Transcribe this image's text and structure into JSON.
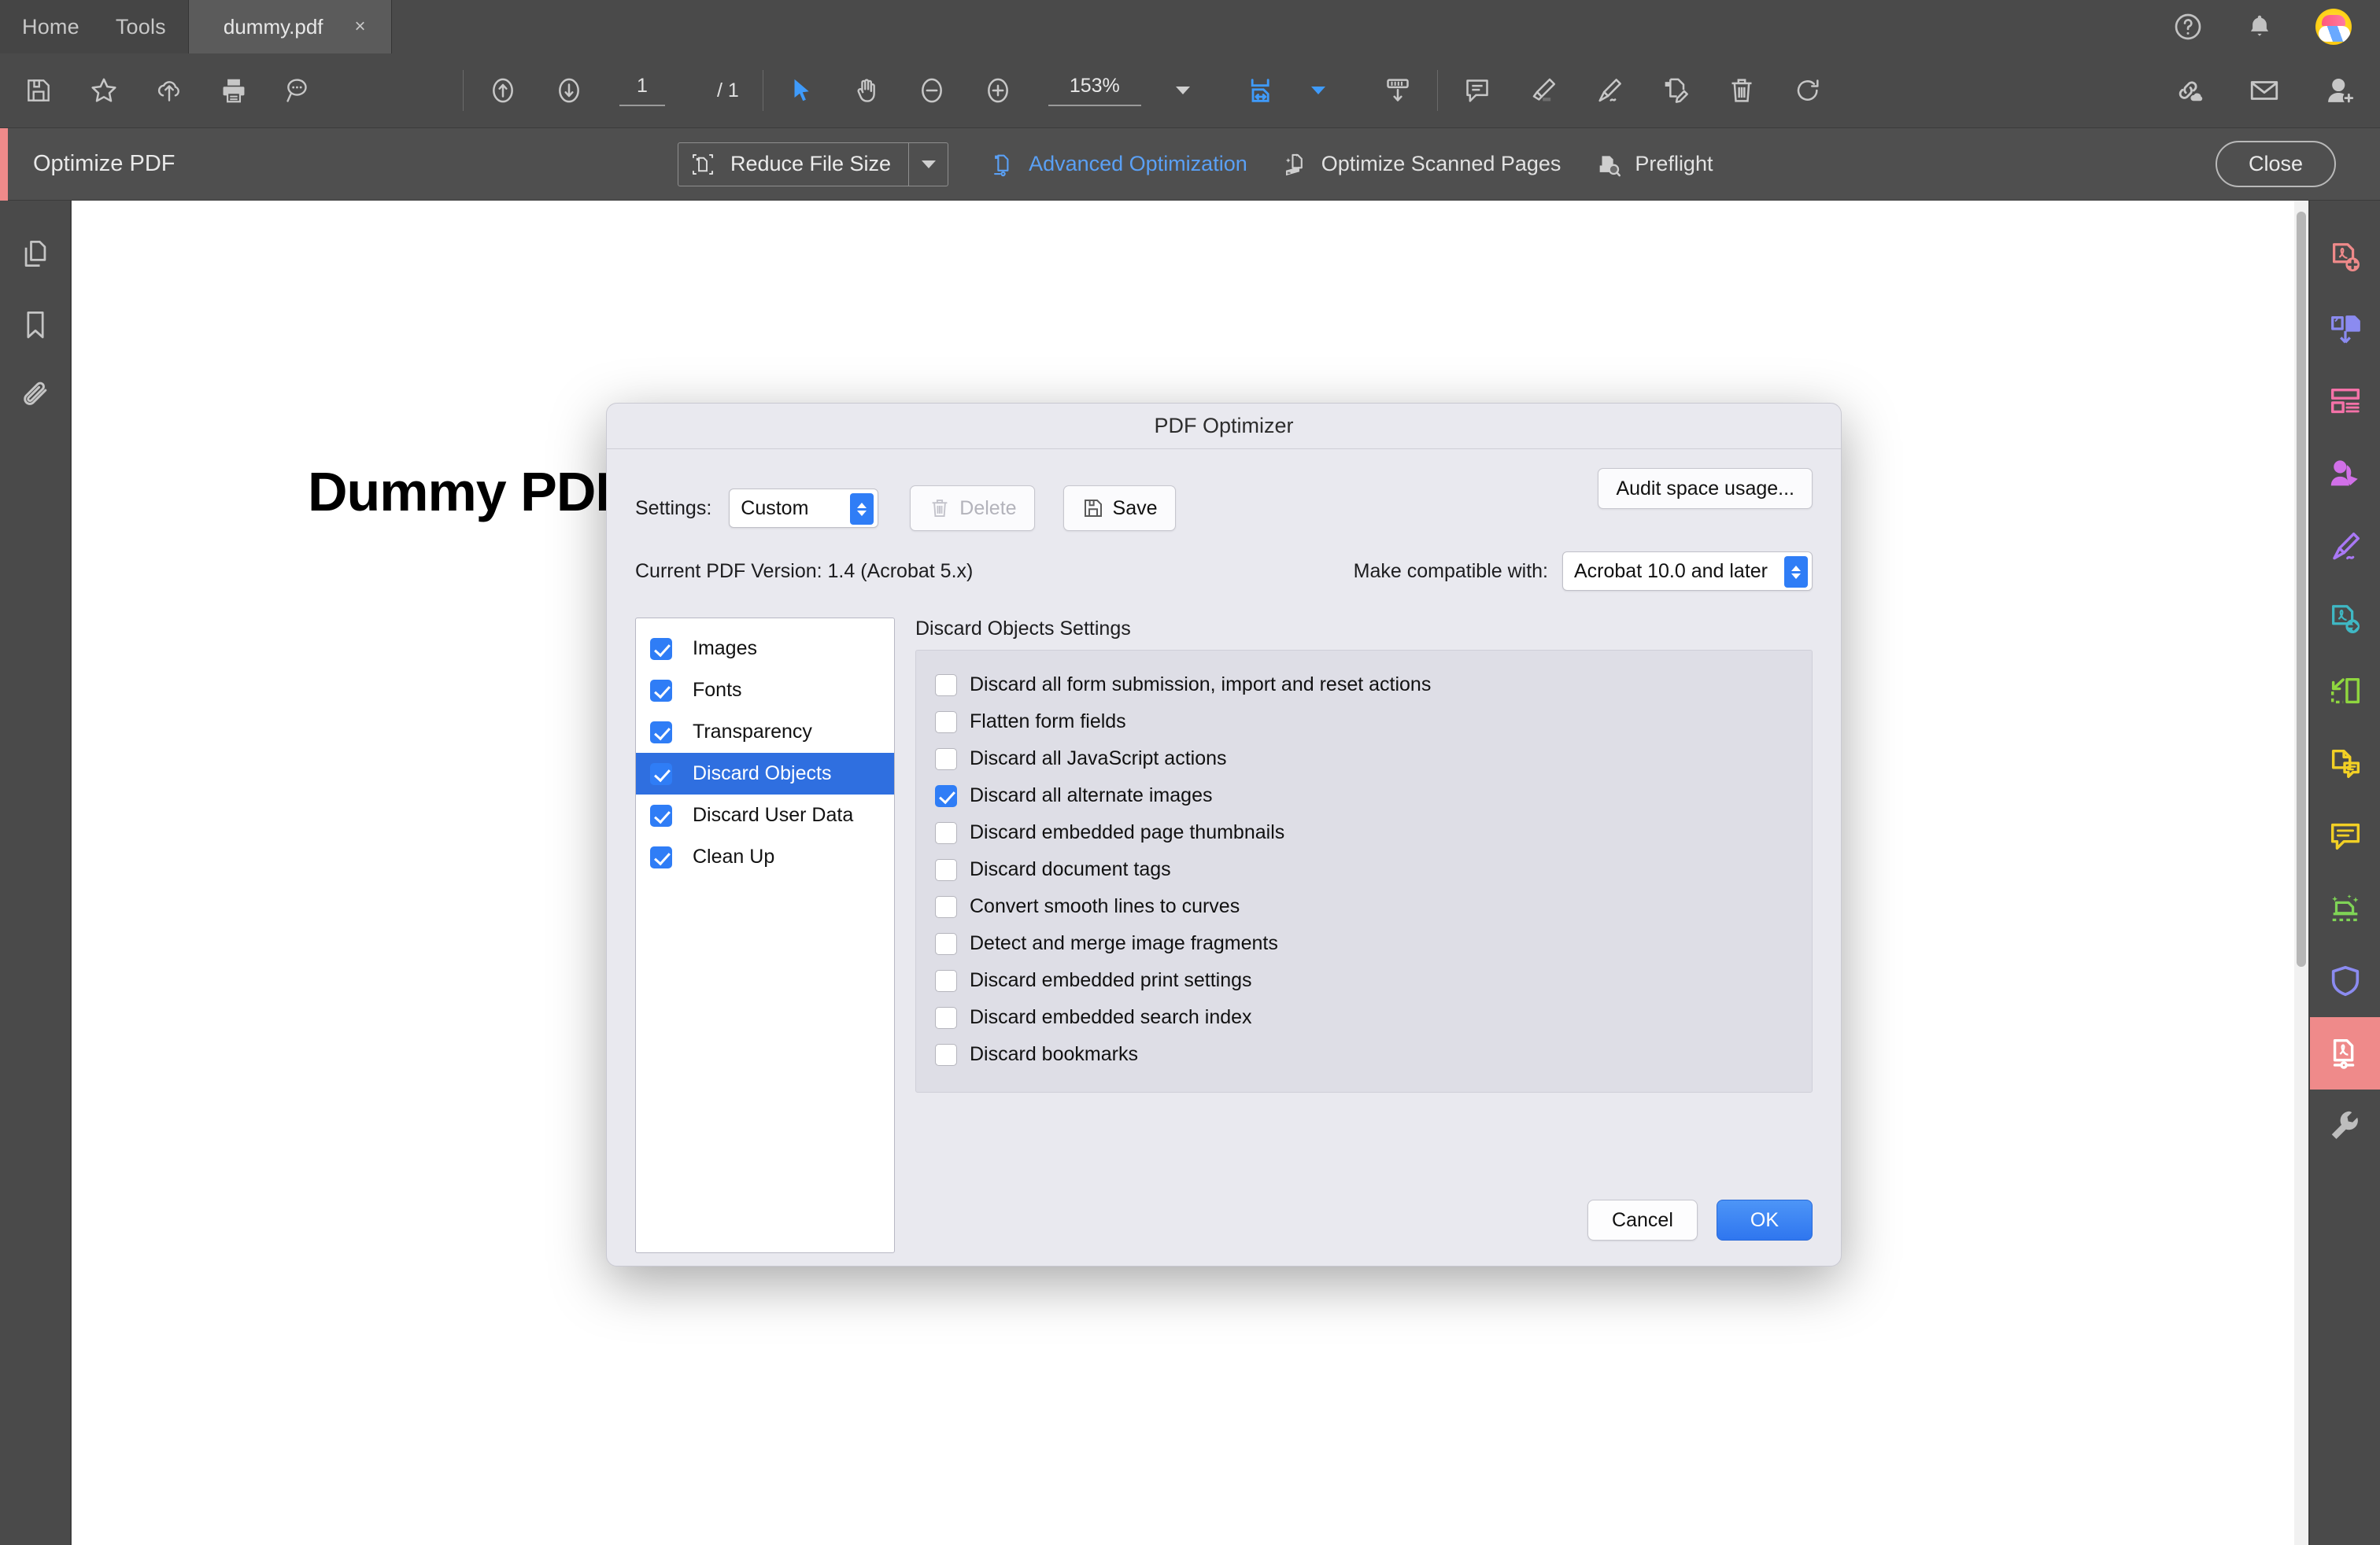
{
  "tabbar": {
    "home_label": "Home",
    "tools_label": "Tools",
    "doc_tab_title": "dummy.pdf",
    "doc_tab_close": "×",
    "help_icon": "help-circle-icon",
    "bell_icon": "notification-bell-icon",
    "avatar_icon": "user-avatar"
  },
  "toolbar": {
    "save_icon": "save-floppy-icon",
    "star_icon": "add-to-favorites-star-icon",
    "upload_icon": "upload-cloud-icon",
    "print_icon": "print-icon",
    "search_icon": "search-magnifier-icon",
    "prev_page_icon": "previous-page-arrow-up-icon",
    "next_page_icon": "next-page-arrow-down-icon",
    "page_current": "1",
    "page_total": "/ 1",
    "select_tool_icon": "select-cursor-icon",
    "hand_tool_icon": "hand-pan-icon",
    "zoom_out_icon": "zoom-out-minus-icon",
    "zoom_in_icon": "zoom-in-plus-icon",
    "zoom_value": "153%",
    "fit_page_icon": "fit-page-width-icon",
    "scroll_mode_icon": "scroll-mode-icon",
    "comment_icon": "add-comment-icon",
    "highlight_icon": "highlight-marker-icon",
    "sign_icon": "fill-and-sign-icon",
    "edit_pdf_icon": "edit-pdf-icon",
    "delete_icon": "delete-trash-icon",
    "rotate_icon": "rotate-clockwise-icon",
    "share_link_icon": "share-link-cloud-icon",
    "email_icon": "email-envelope-icon",
    "add_user_icon": "add-person-icon"
  },
  "optimize_bar": {
    "title": "Optimize PDF",
    "reduce_file_size": "Reduce File Size",
    "reduce_icon": "reduce-file-size-icon",
    "advanced_optimization": "Advanced Optimization",
    "advanced_icon": "advanced-optimization-icon",
    "optimize_scanned_pages": "Optimize Scanned Pages",
    "scanned_icon": "optimize-scanned-pages-icon",
    "preflight": "Preflight",
    "preflight_icon": "preflight-icon",
    "close_label": "Close",
    "active_color": "#5aa0f5",
    "accent_color": "#ef8a8a"
  },
  "left_rail": {
    "items": [
      {
        "icon": "page-thumbnails-icon",
        "name": "page-thumbnails"
      },
      {
        "icon": "bookmarks-icon",
        "name": "bookmarks"
      },
      {
        "icon": "attachments-paperclip-icon",
        "name": "attachments"
      }
    ]
  },
  "right_rail": {
    "items": [
      {
        "icon": "create-pdf-icon",
        "color": "#ef8a8a",
        "selected": false
      },
      {
        "icon": "combine-files-icon",
        "color": "#8b8bf0",
        "selected": false
      },
      {
        "icon": "organize-pages-icon",
        "color": "#f472a8",
        "selected": false
      },
      {
        "icon": "request-signatures-icon",
        "color": "#d170e8",
        "selected": false
      },
      {
        "icon": "fill-and-sign-icon",
        "color": "#a978f5",
        "selected": false
      },
      {
        "icon": "export-pdf-icon",
        "color": "#3fb8c4",
        "selected": false
      },
      {
        "icon": "crop-pages-icon",
        "color": "#8fd63f",
        "selected": false
      },
      {
        "icon": "compare-files-icon",
        "color": "#f2d025",
        "selected": false
      },
      {
        "icon": "comment-icon",
        "color": "#f2d025",
        "selected": false
      },
      {
        "icon": "enhance-scans-icon",
        "color": "#7fd456",
        "selected": false
      },
      {
        "icon": "protect-shield-icon",
        "color": "#8b8bf0",
        "selected": false
      },
      {
        "icon": "optimize-pdf-icon",
        "color": "#ffffff",
        "selected": true
      },
      {
        "icon": "more-tools-wrench-icon",
        "color": "#bdbdbd",
        "selected": false
      }
    ]
  },
  "document": {
    "heading": "Dummy PDF"
  },
  "dialog": {
    "title": "PDF Optimizer",
    "settings_label": "Settings:",
    "settings_value": "Custom",
    "delete_label": "Delete",
    "delete_icon": "delete-trash-icon",
    "save_label": "Save",
    "save_icon": "save-floppy-icon",
    "audit_label": "Audit space usage...",
    "current_version": "Current PDF Version: 1.4 (Acrobat 5.x)",
    "compat_label": "Make compatible with:",
    "compat_value": "Acrobat 10.0 and later",
    "categories": [
      {
        "label": "Images",
        "checked": true,
        "selected": false
      },
      {
        "label": "Fonts",
        "checked": true,
        "selected": false
      },
      {
        "label": "Transparency",
        "checked": true,
        "selected": false
      },
      {
        "label": "Discard Objects",
        "checked": true,
        "selected": true
      },
      {
        "label": "Discard User Data",
        "checked": true,
        "selected": false
      },
      {
        "label": "Clean Up",
        "checked": true,
        "selected": false
      }
    ],
    "settings_panel_title": "Discard Objects Settings",
    "options": [
      {
        "label": "Discard all form submission, import and reset actions",
        "checked": false
      },
      {
        "label": "Flatten form fields",
        "checked": false
      },
      {
        "label": "Discard all JavaScript actions",
        "checked": false
      },
      {
        "label": "Discard all alternate images",
        "checked": true
      },
      {
        "label": "Discard embedded page thumbnails",
        "checked": false
      },
      {
        "label": "Discard document tags",
        "checked": false
      },
      {
        "label": "Convert smooth lines to curves",
        "checked": false
      },
      {
        "label": "Detect and merge image fragments",
        "checked": false
      },
      {
        "label": "Discard embedded print settings",
        "checked": false
      },
      {
        "label": "Discard embedded search index",
        "checked": false
      },
      {
        "label": "Discard bookmarks",
        "checked": false
      }
    ],
    "cancel_label": "Cancel",
    "ok_label": "OK",
    "accent_blue": "#2f7df6",
    "selected_row_blue": "#2f6fe0"
  }
}
